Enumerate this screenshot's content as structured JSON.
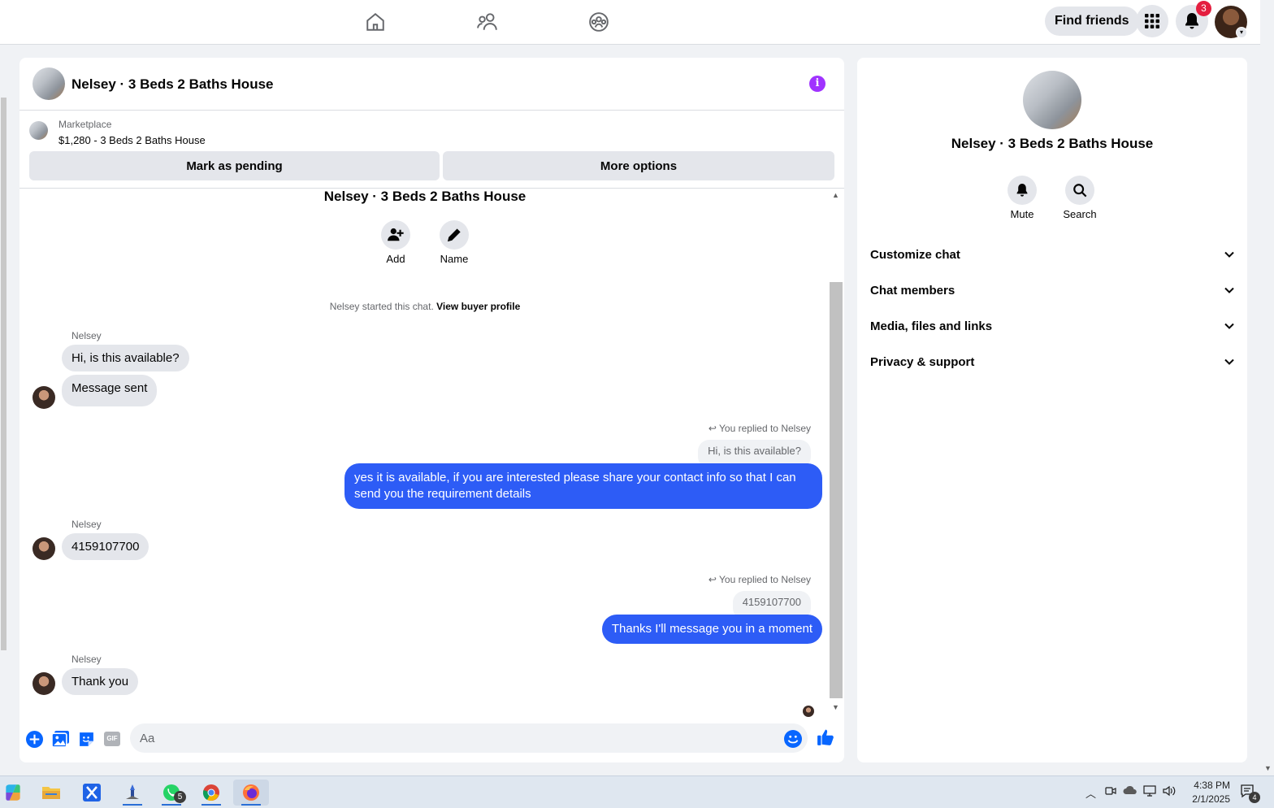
{
  "topbar": {
    "nav_icons": [
      "home-icon",
      "friends-icon",
      "groups-icon"
    ],
    "find_friends_label": "Find friends",
    "notification_count": "3"
  },
  "chat": {
    "header_title": "Nelsey · 3 Beds 2 Baths House",
    "listing": {
      "label": "Marketplace",
      "price_title": "$1,280 - 3 Beds 2 Baths House"
    },
    "mark_pending_label": "Mark as pending",
    "more_options_label": "More options",
    "conversation_title": "Nelsey · 3 Beds 2 Baths House",
    "actions": [
      {
        "label": "Add",
        "icon": "add-person-icon"
      },
      {
        "label": "Name",
        "icon": "pencil-icon"
      }
    ],
    "started_text": "Nelsey started this chat.",
    "view_profile_link": "View buyer profile",
    "messages": [
      {
        "sender": "Nelsey",
        "text": "Hi, is this available?"
      },
      {
        "text": "Message sent"
      },
      {
        "replied_label": "You replied to Nelsey",
        "quoted": "Hi, is this available?",
        "text": "yes it is available, if you are interested please share your contact info so that I can send you the requirement details"
      },
      {
        "sender": "Nelsey",
        "text": "4159107700"
      },
      {
        "replied_label": "You replied to Nelsey",
        "quoted": "4159107700",
        "text": "Thanks I'll message you in a moment"
      },
      {
        "sender": "Nelsey",
        "text": "Thank you"
      }
    ],
    "composer_placeholder": "Aa",
    "gif_label": "GIF"
  },
  "side": {
    "title": "Nelsey · 3 Beds 2 Baths House",
    "actions": [
      {
        "label": "Mute",
        "icon": "bell-icon"
      },
      {
        "label": "Search",
        "icon": "search-icon"
      }
    ],
    "sections": [
      "Customize chat",
      "Chat members",
      "Media, files and links",
      "Privacy & support"
    ]
  },
  "taskbar": {
    "whatsapp_badge": "5",
    "time": "4:38 PM",
    "date": "2/1/2025",
    "notification_count": "4"
  },
  "colors": {
    "accent": "#2d5cf6",
    "link_blue": "#0866ff",
    "info_purple": "#a033ff",
    "badge_red": "#e41e3f"
  }
}
